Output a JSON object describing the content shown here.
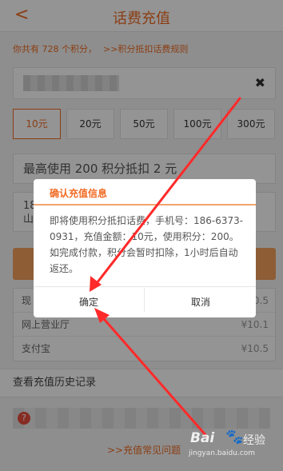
{
  "header": {
    "back_icon": "chevron-left-icon",
    "title": "话费充值"
  },
  "points_info": {
    "text": "你共有 728 个积分，",
    "rules_link": ">>积分抵扣话费规则"
  },
  "phone_input": {
    "clear_icon": "close-icon",
    "clear_symbol": "✖"
  },
  "amounts": [
    {
      "label": "10元",
      "selected": true
    },
    {
      "label": "20元",
      "selected": false
    },
    {
      "label": "50元",
      "selected": false
    },
    {
      "label": "100元",
      "selected": false
    },
    {
      "label": "300元",
      "selected": false
    }
  ],
  "use_points": {
    "text": "最高使用 200 积分抵扣 2 元"
  },
  "carrier": {
    "line1": "18",
    "line2": "山"
  },
  "pay_options": [
    {
      "label": "现",
      "price": "¥10.5"
    },
    {
      "label": "网上营业厅",
      "price": "¥10.1"
    },
    {
      "label": "支付宝",
      "price": "¥10.5"
    }
  ],
  "history": {
    "label": "查看充值历史记录"
  },
  "faq": {
    "help_icon": "question-circle-icon",
    "link": ">>充值常见问题"
  },
  "dialog": {
    "title": "确认充值信息",
    "body": "即将使用积分抵扣话费，手机号：186-6373-0931，充值金额：10元，使用积分：200。 如完成付款，积分会暂时扣除，1小时后自动返还。",
    "ok_label": "确定",
    "cancel_label": "取消"
  },
  "watermark": {
    "brand": "Bai",
    "brand2": "经验",
    "url": "jingyan.baidu.com"
  },
  "colors": {
    "accent": "#f06b24",
    "annotation": "#ff2a2a"
  }
}
